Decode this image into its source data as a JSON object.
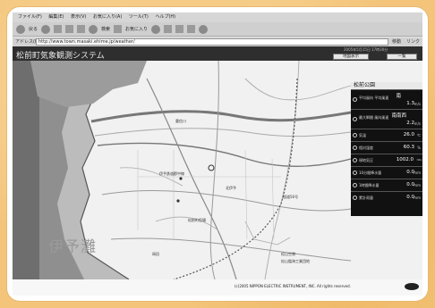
{
  "browser": {
    "menu": [
      "ファイル(F)",
      "編集(E)",
      "表示(V)",
      "お気に入り(A)",
      "ツール(T)",
      "ヘルプ(H)"
    ],
    "toolbar_labels": {
      "back": "戻る",
      "search": "検索",
      "favorites": "お気に入り"
    },
    "address_label": "アドレス(D)",
    "address_value": "http://www.town.masaki.ehime.jp/weather/",
    "go_label": "移動",
    "links_label": "リンク"
  },
  "app": {
    "title": "松前町気象観測システム",
    "datetime": "2005年5月15日 17時30分",
    "tabs": [
      "地図表示",
      "一覧"
    ]
  },
  "map": {
    "sea_label": "伊予灘",
    "places": [
      "重信川",
      "伊予鉄道郡中線",
      "北伊予",
      "松前町役場",
      "岡田",
      "松山空港",
      "国道56号",
      "松山臨海工業団地"
    ]
  },
  "panel": {
    "title": "松前公園",
    "rows": [
      {
        "icon": "wind-direction-icon",
        "label": "平均風向\n平均風速",
        "value": "南",
        "value2": "1.3",
        "unit": "m/s"
      },
      {
        "icon": "max-wind-icon",
        "label": "最大瞬間\n風向風速",
        "value": "南南西",
        "value2": "2.2",
        "unit": "m/s"
      },
      {
        "icon": "temperature-icon",
        "label": "気温",
        "value": "26.0",
        "unit": "℃"
      },
      {
        "icon": "humidity-icon",
        "label": "相対湿度",
        "value": "60.3",
        "unit": "%"
      },
      {
        "icon": "pressure-icon",
        "label": "現地気圧",
        "value": "1002.0",
        "unit": "hPa"
      },
      {
        "icon": "rain-10min-icon",
        "label": "10分間降水量",
        "value": "0.0",
        "unit": "mm"
      },
      {
        "icon": "rain-hourly-icon",
        "label": "1時間降水量",
        "value": "0.0",
        "unit": "mm"
      },
      {
        "icon": "rain-total-icon",
        "label": "累計雨量",
        "value": "0.0",
        "unit": "mm"
      }
    ]
  },
  "footer": {
    "copyright": "(c)2005 NIPPON ELECTRIC INSTRUMENT, INC. All rights reserved."
  }
}
